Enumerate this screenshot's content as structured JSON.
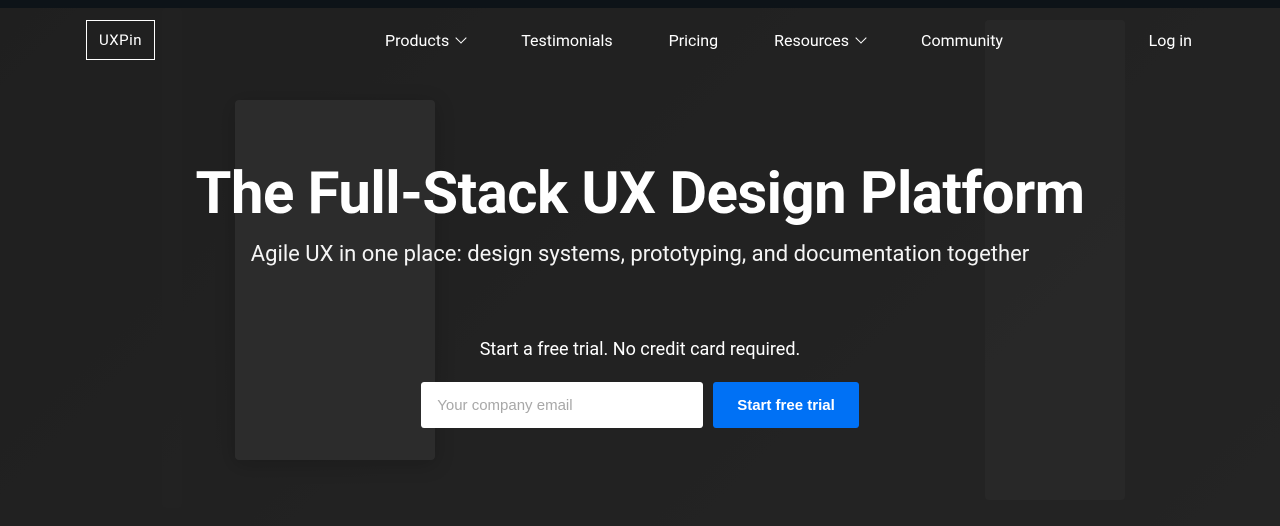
{
  "brand": {
    "logo_text": "UXPin"
  },
  "nav": {
    "products": "Products",
    "testimonials": "Testimonials",
    "pricing": "Pricing",
    "resources": "Resources",
    "community": "Community",
    "login": "Log in"
  },
  "hero": {
    "title": "The Full-Stack UX Design Platform",
    "subtitle": "Agile UX in one place: design systems, prototyping, and documentation together",
    "trial_label": "Start a free trial. No credit card required.",
    "email_placeholder": "Your company email",
    "cta_label": "Start free trial"
  },
  "colors": {
    "primary": "#0071f5",
    "text": "#ffffff",
    "bg_dark": "#2a2a2a"
  }
}
